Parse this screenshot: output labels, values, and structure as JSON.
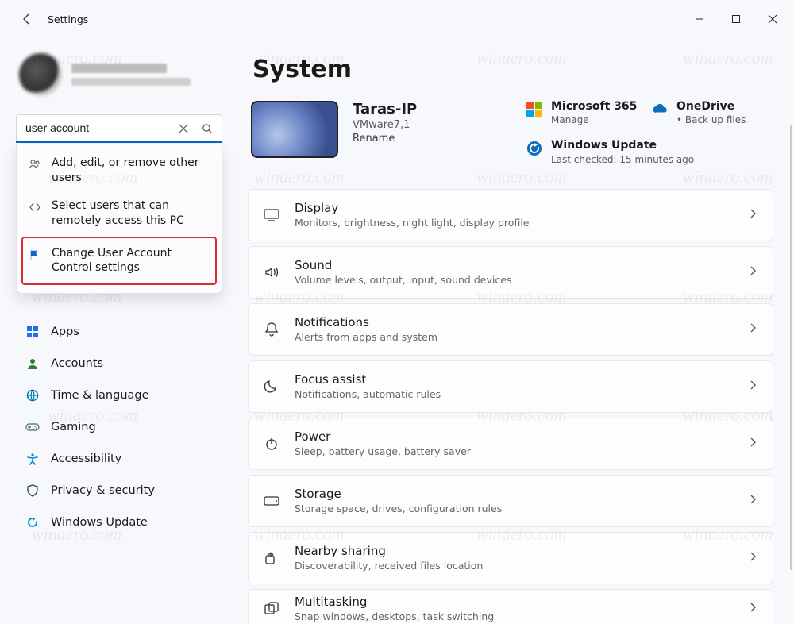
{
  "titlebar": {
    "title": "Settings"
  },
  "search": {
    "value": "user account"
  },
  "search_results": [
    {
      "id": "add-edit-remove-users",
      "icon": "users-icon",
      "label": "Add, edit, or remove other users"
    },
    {
      "id": "remote-users",
      "icon": "chevron-left-right-icon",
      "label": "Select users that can remotely access this PC"
    },
    {
      "id": "uac-settings",
      "icon": "flag-icon",
      "label": "Change User Account Control settings",
      "highlight": true
    }
  ],
  "nav": [
    {
      "id": "apps",
      "label": "Apps",
      "icon": "apps-icon",
      "color": "#1f6feb"
    },
    {
      "id": "accounts",
      "label": "Accounts",
      "icon": "person-icon",
      "color": "#2e7d32"
    },
    {
      "id": "time-language",
      "label": "Time & language",
      "icon": "globe-icon",
      "color": "#0277bd"
    },
    {
      "id": "gaming",
      "label": "Gaming",
      "icon": "gamepad-icon",
      "color": "#607d8b"
    },
    {
      "id": "accessibility",
      "label": "Accessibility",
      "icon": "accessibility-icon",
      "color": "#0288d1"
    },
    {
      "id": "privacy",
      "label": "Privacy & security",
      "icon": "shield-icon",
      "color": "#37474f"
    },
    {
      "id": "windows-update",
      "label": "Windows Update",
      "icon": "update-icon",
      "color": "#0288d1"
    }
  ],
  "page_title": "System",
  "pc": {
    "name": "Taras-IP",
    "model": "VMware7,1",
    "rename": "Rename"
  },
  "cloud": {
    "m365": {
      "title": "Microsoft 365",
      "sub": "Manage"
    },
    "onedrive": {
      "title": "OneDrive",
      "sub": "• Back up files"
    },
    "update": {
      "title": "Windows Update",
      "sub": "Last checked: 15 minutes ago"
    }
  },
  "rows": [
    {
      "id": "display",
      "icon": "display-icon",
      "title": "Display",
      "sub": "Monitors, brightness, night light, display profile"
    },
    {
      "id": "sound",
      "icon": "sound-icon",
      "title": "Sound",
      "sub": "Volume levels, output, input, sound devices"
    },
    {
      "id": "notifications",
      "icon": "bell-icon",
      "title": "Notifications",
      "sub": "Alerts from apps and system"
    },
    {
      "id": "focus-assist",
      "icon": "moon-icon",
      "title": "Focus assist",
      "sub": "Notifications, automatic rules"
    },
    {
      "id": "power",
      "icon": "power-icon",
      "title": "Power",
      "sub": "Sleep, battery usage, battery saver"
    },
    {
      "id": "storage",
      "icon": "storage-icon",
      "title": "Storage",
      "sub": "Storage space, drives, configuration rules"
    },
    {
      "id": "nearby-sharing",
      "icon": "share-icon",
      "title": "Nearby sharing",
      "sub": "Discoverability, received files location"
    },
    {
      "id": "multitasking",
      "icon": "multitask-icon",
      "title": "Multitasking",
      "sub": "Snap windows, desktops, task switching"
    }
  ],
  "watermark": "winaero.com"
}
